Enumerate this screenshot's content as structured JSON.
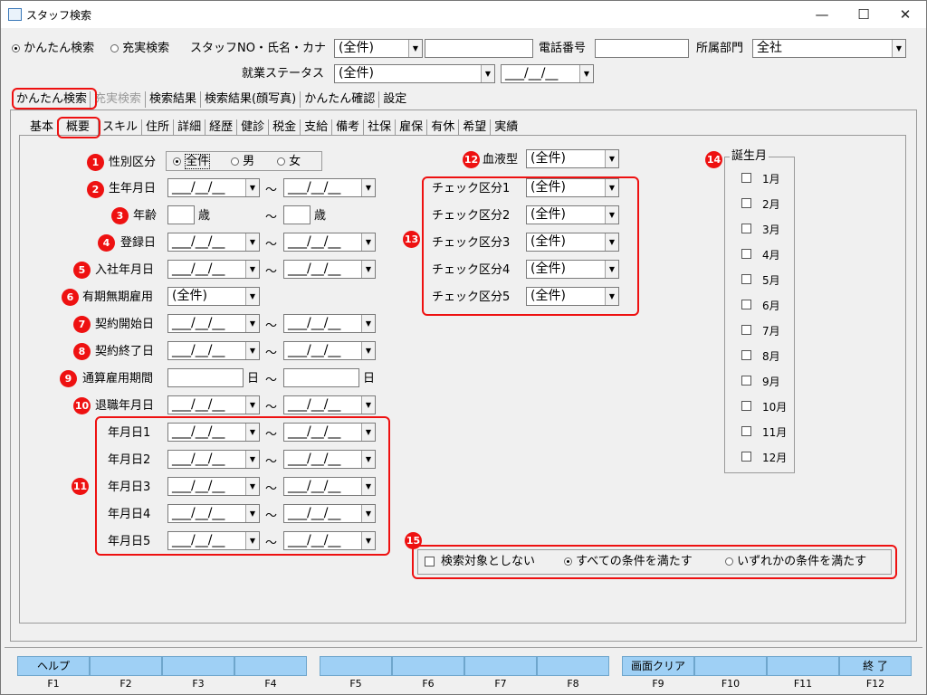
{
  "window": {
    "title": "スタッフ検索",
    "minimize": "—",
    "maximize": "☐",
    "close": "✕"
  },
  "top": {
    "radio_easy": "かんたん検索",
    "radio_full": "充実検索",
    "staff_label": "スタッフNO・氏名・カナ",
    "staff_select": "(全件)",
    "phone_label": "電話番号",
    "dept_label": "所属部門",
    "dept_value": "全社",
    "work_status_label": "就業ステータス",
    "work_status_value": "(全件)",
    "date_value": "___/__/__"
  },
  "main_tabs": [
    "かんたん検索",
    "充実検索",
    "検索結果",
    "検索結果(顔写真)",
    "かんたん確認",
    "設定"
  ],
  "sub_tabs": [
    "基本",
    "概要",
    "スキル",
    "住所",
    "詳細",
    "経歴",
    "健診",
    "税金",
    "支給",
    "備考",
    "社保",
    "雇保",
    "有休",
    "希望",
    "実績"
  ],
  "numbers": [
    "1",
    "2",
    "3",
    "4",
    "5",
    "6",
    "7",
    "8",
    "9",
    "10",
    "11",
    "12",
    "13",
    "14",
    "15"
  ],
  "gender": {
    "label": "性別区分",
    "all": "全件",
    "male": "男",
    "female": "女"
  },
  "fields": {
    "birth": "生年月日",
    "age": "年齢",
    "age_unit": "歳",
    "registered": "登録日",
    "joined": "入社年月日",
    "fixed_term": "有期無期雇用",
    "fixed_term_value": "(全件)",
    "contract_start": "契約開始日",
    "contract_end": "契約終了日",
    "total_period": "通算雇用期間",
    "day_unit": "日",
    "retired": "退職年月日",
    "date1": "年月日1",
    "date2": "年月日2",
    "date3": "年月日3",
    "date4": "年月日4",
    "date5": "年月日5",
    "tilde": "〜",
    "date_placeholder": "___/__/__"
  },
  "blood": {
    "label": "血液型",
    "value": "(全件)"
  },
  "checks": [
    {
      "label": "チェック区分1",
      "value": "(全件)"
    },
    {
      "label": "チェック区分2",
      "value": "(全件)"
    },
    {
      "label": "チェック区分3",
      "value": "(全件)"
    },
    {
      "label": "チェック区分4",
      "value": "(全件)"
    },
    {
      "label": "チェック区分5",
      "value": "(全件)"
    }
  ],
  "birth_month": {
    "title": "誕生月",
    "months": [
      "1月",
      "2月",
      "3月",
      "4月",
      "5月",
      "6月",
      "7月",
      "8月",
      "9月",
      "10月",
      "11月",
      "12月"
    ]
  },
  "options": {
    "exclude": "検索対象としない",
    "all_conditions": "すべての条件を満たす",
    "any_condition": "いずれかの条件を満たす"
  },
  "fkeys": [
    {
      "label": "ヘルプ",
      "key": "F1"
    },
    {
      "label": "",
      "key": "F2"
    },
    {
      "label": "",
      "key": "F3"
    },
    {
      "label": "",
      "key": "F4"
    },
    {
      "label": "",
      "key": "F5"
    },
    {
      "label": "",
      "key": "F6"
    },
    {
      "label": "",
      "key": "F7"
    },
    {
      "label": "",
      "key": "F8"
    },
    {
      "label": "画面クリア",
      "key": "F9"
    },
    {
      "label": "",
      "key": "F10"
    },
    {
      "label": "",
      "key": "F11"
    },
    {
      "label": "終 了",
      "key": "F12"
    }
  ],
  "colors": {
    "accent": "#e11111",
    "fkey_bg": "#9fd0f5"
  }
}
